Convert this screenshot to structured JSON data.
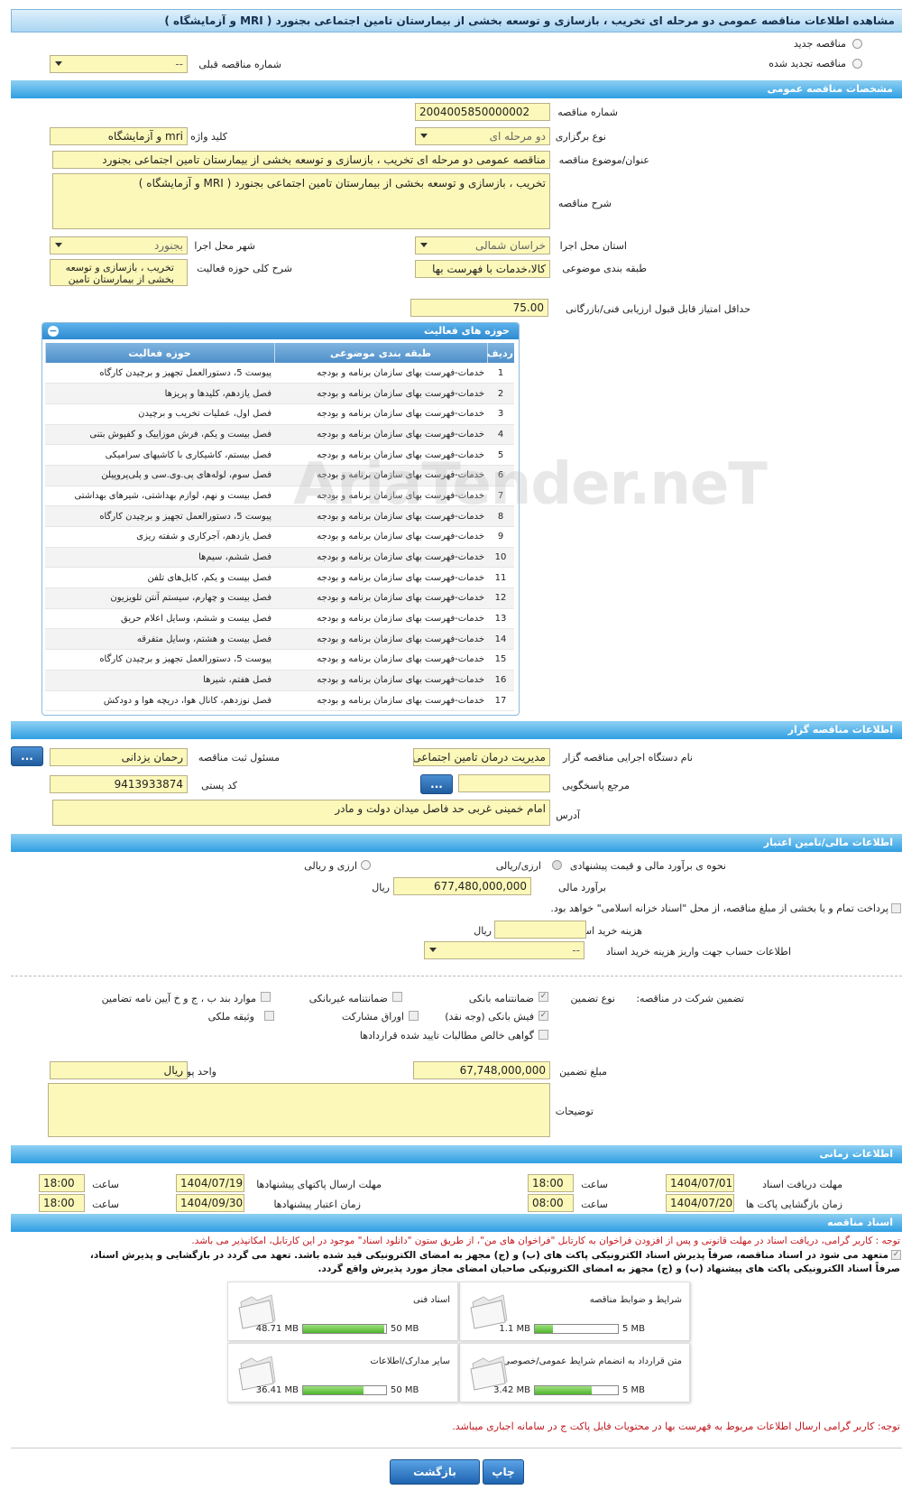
{
  "page_title": "مشاهده اطلاعات مناقصه عمومی دو مرحله ای تخریب ، بازسازی و توسعه بخشی از بیمارستان تامین اجتماعی بجنورد ( MRI و آزمایشگاه )",
  "tender_type": {
    "new_label": "مناقصه جدید",
    "renewed_label": "مناقصه تجدید شده",
    "prev_number_label": "شماره مناقصه قبلی",
    "prev_number_value": "--"
  },
  "general": {
    "section_title": "مشخصات مناقصه عمومی",
    "number_label": "شماره مناقصه",
    "number_value": "2004005850000002",
    "holding_label": "نوع برگزاری",
    "holding_value": "دو مرحله ای",
    "keyword_label": "کلید واژه",
    "keyword_value": "mri و آزمایشگاه",
    "subject_label": "عنوان/موضوع مناقصه",
    "subject_value": "مناقصه عمومی دو مرحله ای تخریب ، بازسازی  و توسعه بخشی از بیمارستان تامین اجتماعی بجنورد",
    "desc_label": "شرح مناقصه",
    "desc_value": "تخریب ، بازسازی  و توسعه بخشی از بیمارستان تامین اجتماعی بجنورد ( MRI و آزمایشگاه )",
    "province_label": "استان محل اجرا",
    "province_value": "خراسان شمالی",
    "city_label": "شهر محل اجرا",
    "city_value": "بجنورد",
    "category_label": "طبقه بندی موضوعی",
    "category_value": "کالا،خدمات با فهرست بها",
    "scope_label": "شرح کلی حوزه فعالیت",
    "scope_value": "تخریب ، بازسازی  و توسعه بخشی از بیمارستان تامین",
    "min_score_label": "حداقل امتیاز قابل قبول ارزیابی فنی/بازرگانی",
    "min_score_value": "75.00"
  },
  "activities": {
    "title": "حوزه های فعالیت",
    "toggle": "−",
    "col_row": "ردیف",
    "col_category": "طبقه بندی موضوعی",
    "col_activity": "حوزه فعالیت",
    "rows": [
      {
        "n": "1",
        "cat": "خدمات-فهرست بهای سازمان برنامه و بودجه",
        "act": "پیوست 5، دستورالعمل تجهیز و برچیدن کارگاه"
      },
      {
        "n": "2",
        "cat": "خدمات-فهرست بهای سازمان برنامه و بودجه",
        "act": "فصل یازدهم، کلیدها و پریزها"
      },
      {
        "n": "3",
        "cat": "خدمات-فهرست بهای سازمان برنامه و بودجه",
        "act": "فصل اول، عملیات تخریب و برچیدن"
      },
      {
        "n": "4",
        "cat": "خدمات-فهرست بهای سازمان برنامه و بودجه",
        "act": "فصل بیست و یکم، فرش موزاییک و کفپوش بتنی"
      },
      {
        "n": "5",
        "cat": "خدمات-فهرست بهای سازمان برنامه و بودجه",
        "act": "فصل بیستم، کاشیکاری با کاشیهای سرامیکی"
      },
      {
        "n": "6",
        "cat": "خدمات-فهرست بهای سازمان برنامه و بودجه",
        "act": "فصل سوم، لوله‌های پی.وی.سی و پلی‌پروپیلن"
      },
      {
        "n": "7",
        "cat": "خدمات-فهرست بهای سازمان برنامه و بودجه",
        "act": "فصل بیست و نهم، لوازم بهداشتی، شیرهای بهداشتی"
      },
      {
        "n": "8",
        "cat": "خدمات-فهرست بهای سازمان برنامه و بودجه",
        "act": "پیوست 5، دستورالعمل تجهیز و برچیدن کارگاه"
      },
      {
        "n": "9",
        "cat": "خدمات-فهرست بهای سازمان برنامه و بودجه",
        "act": "فصل یازدهم، آجرکاری و شفته ریزی"
      },
      {
        "n": "10",
        "cat": "خدمات-فهرست بهای سازمان برنامه و بودجه",
        "act": "فصل ششم، سیم‌ها"
      },
      {
        "n": "11",
        "cat": "خدمات-فهرست بهای سازمان برنامه و بودجه",
        "act": "فصل بیست و یکم، کابل‌های تلفن"
      },
      {
        "n": "12",
        "cat": "خدمات-فهرست بهای سازمان برنامه و بودجه",
        "act": "فصل بیست و چهارم، سیستم آنتن تلویزیون"
      },
      {
        "n": "13",
        "cat": "خدمات-فهرست بهای سازمان برنامه و بودجه",
        "act": "فصل بیست و ششم، وسایل اعلام حریق"
      },
      {
        "n": "14",
        "cat": "خدمات-فهرست بهای سازمان برنامه و بودجه",
        "act": "فصل بیست و هشتم، وسایل متفرقه"
      },
      {
        "n": "15",
        "cat": "خدمات-فهرست بهای سازمان برنامه و بودجه",
        "act": "پیوست 5، دستورالعمل تجهیز و برچیدن کارگاه"
      },
      {
        "n": "16",
        "cat": "خدمات-فهرست بهای سازمان برنامه و بودجه",
        "act": "فصل هفتم، شیرها"
      },
      {
        "n": "17",
        "cat": "خدمات-فهرست بهای سازمان برنامه و بودجه",
        "act": "فصل نوزدهم، کانال هوا، دریچه هوا و دودکش"
      }
    ]
  },
  "organizer": {
    "section_title": "اطلاعات مناقصه گزار",
    "org_label": "نام دستگاه اجرایی مناقصه گزار",
    "org_value": "مدیریت درمان تامین اجتماعی",
    "registrar_label": "مسئول ثبت مناقصه",
    "registrar_value": "رحمان یزدانی",
    "ref_label": "مرجع پاسخگویی",
    "ref_value": "",
    "postal_label": "کد پستی",
    "postal_value": "9413933874",
    "address_label": "آدرس",
    "address_value": "امام خمینی غربی حد فاصل میدان دولت و مادر",
    "dots": "..."
  },
  "financial": {
    "section_title": "اطلاعات مالی/تامین اعتبار",
    "estimate_method_label": "نحوه ی برآورد مالی و قیمت پیشنهادی",
    "opt_rial": "ارزی/ریالی",
    "opt_fx": "ارزی و ریالی",
    "estimate_label": "برآورد مالی",
    "estimate_value": "677,480,000,000",
    "rial": "ریال",
    "payment_note": "پرداخت تمام و یا بخشی از مبلغ مناقصه، از محل \"اسناد خزانه اسلامی\" خواهد بود.",
    "doc_cost_label": "هزینه خرید اسناد",
    "doc_cost_value": "",
    "account_label": "اطلاعات حساب جهت واریز هزینه خرید اسناد",
    "account_value": "--"
  },
  "guarantee": {
    "participation_label": "تضمین شرکت در مناقصه:",
    "type_label": "نوع تضمین",
    "options": {
      "bank_guarantee": "ضمانتنامه بانکی",
      "nonbank_guarantee": "ضمانتنامه غیربانکی",
      "items_bcg": "موارد بند ب ، ج و خ آیین نامه تضامین",
      "bank_receipt": "فیش بانکی (وجه نقد)",
      "bonds": "اوراق مشارکت",
      "property": "وثیقه ملکی",
      "claims": "گواهی خالص مطالبات تایید شده قراردادها"
    },
    "amount_label": "مبلغ تضمین",
    "amount_value": "67,748,000,000",
    "currency_label": "واحد پول",
    "currency_value": "ریال",
    "notes_label": "توضیحات",
    "notes_value": ""
  },
  "timing": {
    "section_title": "اطلاعات زمانی",
    "doc_deadline_label": "مهلت دریافت اسناد",
    "doc_deadline_date": "1404/07/01",
    "doc_deadline_time": "18:00",
    "submit_deadline_label": "مهلت ارسال پاکتهای پیشنهادها",
    "submit_deadline_date": "1404/07/19",
    "submit_deadline_time": "18:00",
    "opening_label": "زمان بازگشایی پاکت ها",
    "opening_date": "1404/07/20",
    "opening_time": "08:00",
    "validity_label": "زمان اعتبار پیشنهادها",
    "validity_date": "1404/09/30",
    "validity_time": "18:00",
    "time_label": "ساعت"
  },
  "documents": {
    "section_title": "اسناد مناقصه",
    "note1": "توجه : کاربر گرامی، دریافت اسناد در مهلت قانونی و پس از افزودن فراخوان به کارتابل \"فراخوان های من\"، از طریق ستون \"دانلود اسناد\" موجود در این کارتابل، امکانپذیر می باشد.",
    "commit_line1": "متعهد می شود در اسناد مناقصه، صرفاً پذیرش اسناد الکترونیکی پاکت های (ب) و (ج) مجهز به امضای الکترونیکی قید شده باشد. تعهد می گردد در بازگشایی و پذیرش اسناد،",
    "commit_line2": "صرفاً اسناد الکترونیکی پاکت های پیشنهاد (ب) و (ج) مجهز به امضای الکترونیکی صاحبان امضای مجاز مورد پذیرش واقع گردد.",
    "files": [
      {
        "name": "شرایط و ضوابط مناقصه",
        "used": "1.1 MB",
        "max": "5 MB",
        "ratio": 0.22
      },
      {
        "name": "اسناد فنی",
        "used": "48.71 MB",
        "max": "50 MB",
        "ratio": 0.974
      },
      {
        "name": "متن قرارداد به انضمام شرایط عمومی/خصوصی",
        "used": "3.42 MB",
        "max": "5 MB",
        "ratio": 0.684
      },
      {
        "name": "سایر مدارک/اطلاعات",
        "used": "36.41 MB",
        "max": "50 MB",
        "ratio": 0.728
      }
    ],
    "note2": "توجه: کاربر گرامی ارسال اطلاعات مربوط به فهرست بها در محتویات فایل پاکت ج در سامانه اجباری میباشد."
  },
  "footer": {
    "print_label": "چاپ",
    "back_label": "بازگشت"
  },
  "watermark": "AriaTender.neT"
}
